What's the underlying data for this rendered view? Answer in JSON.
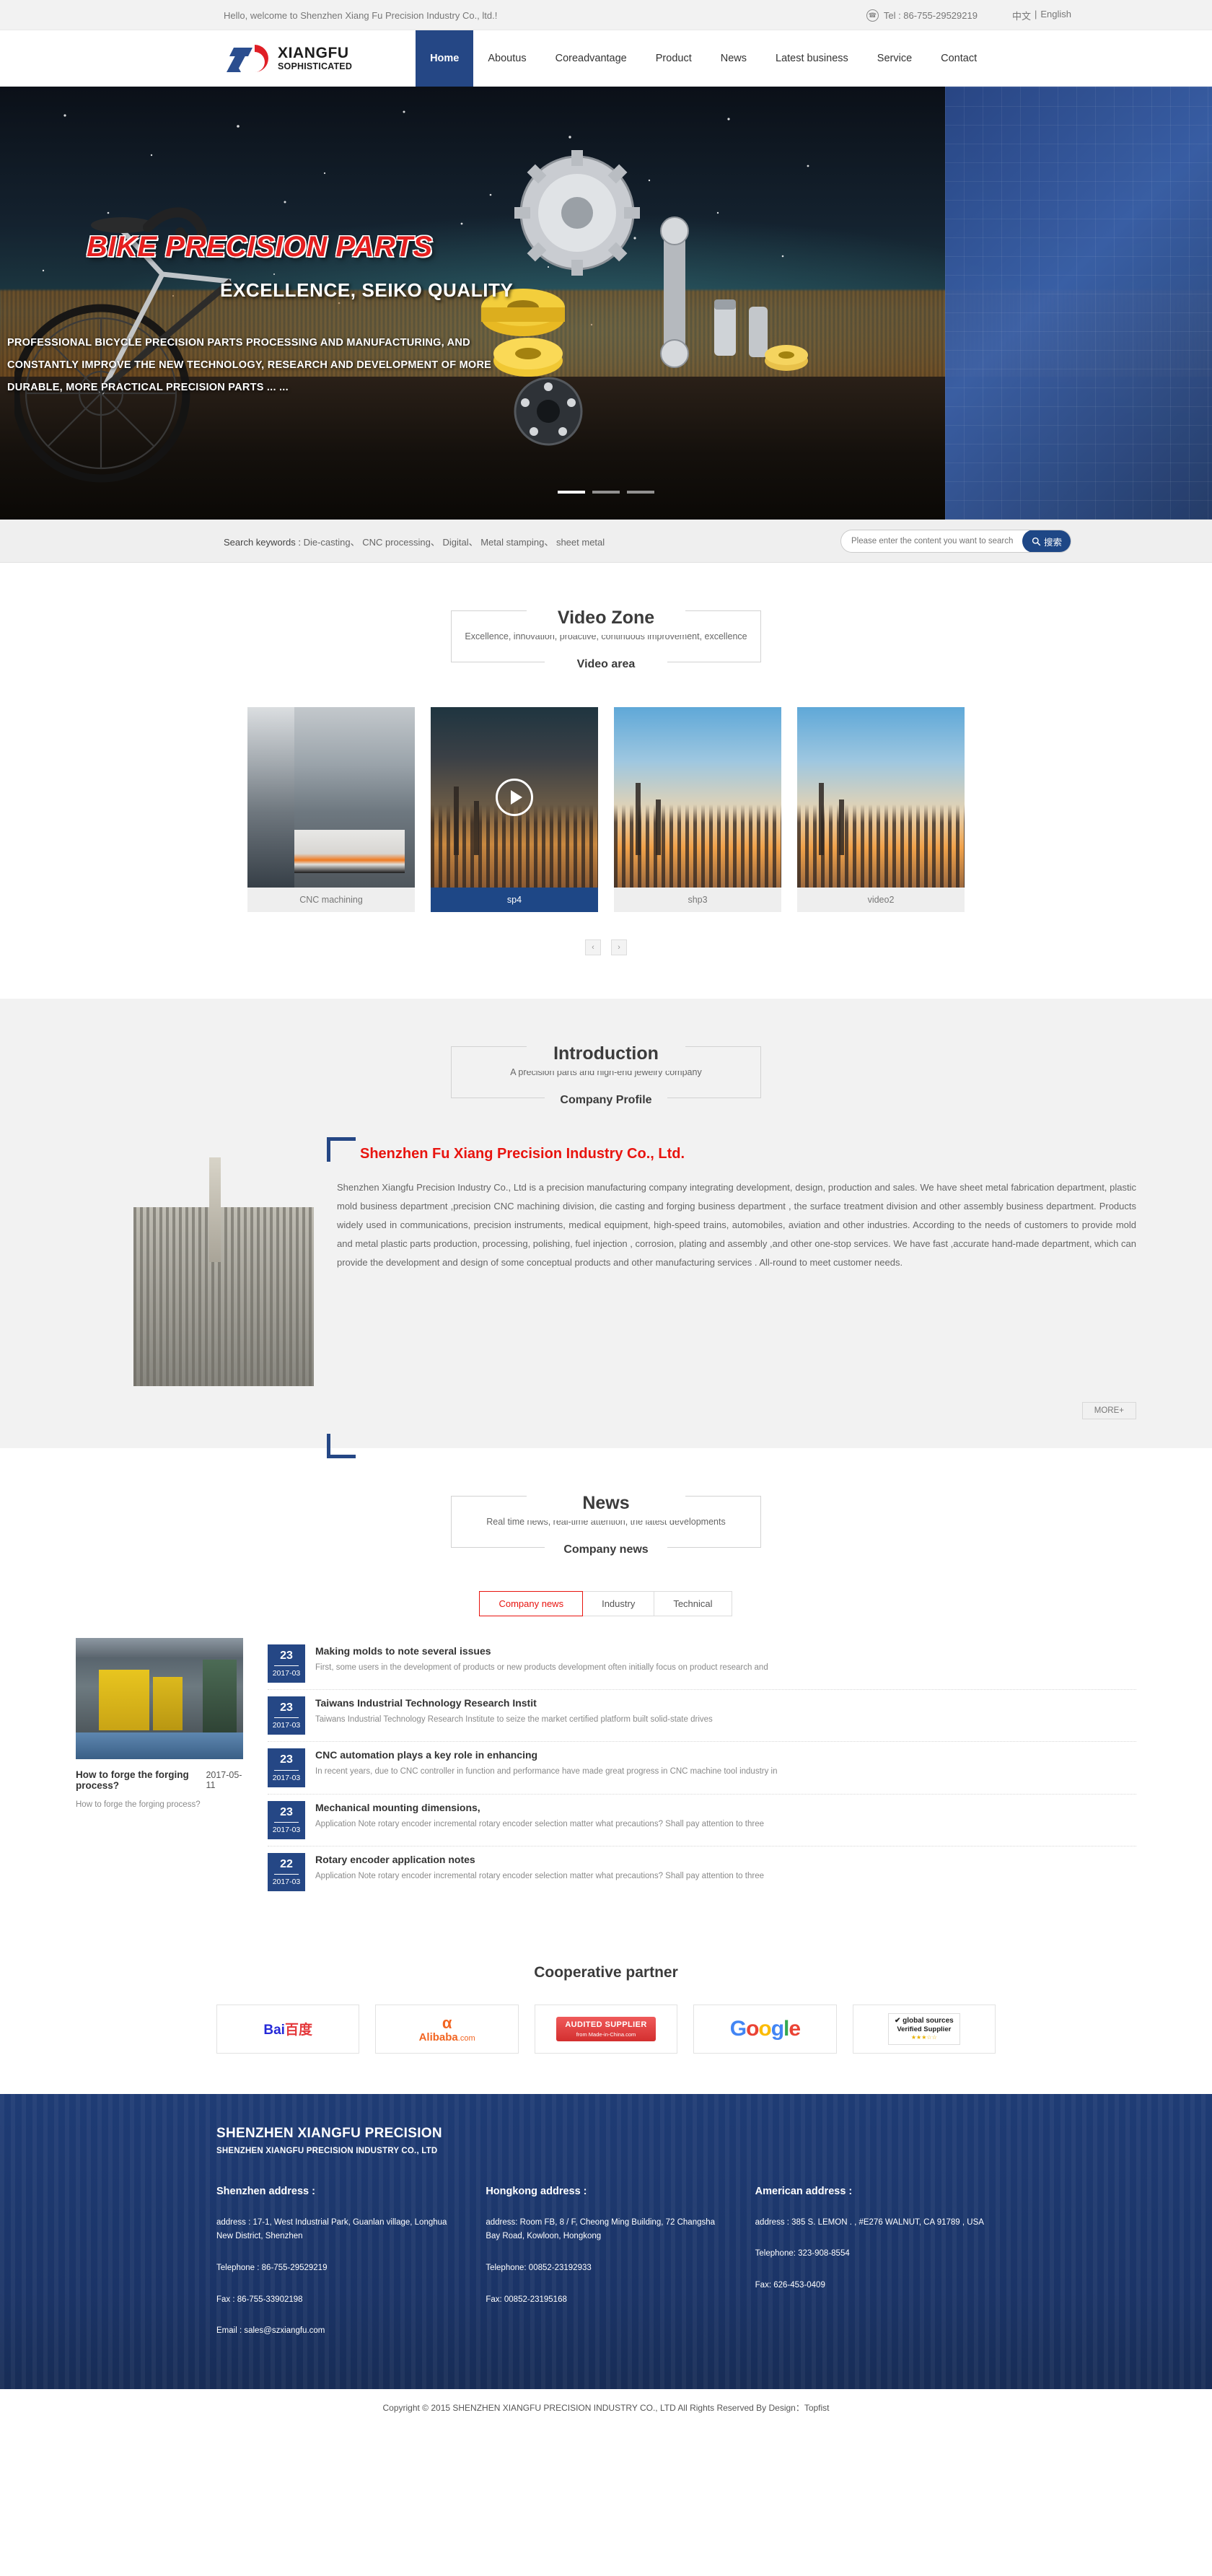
{
  "topbar": {
    "welcome": "Hello, welcome to Shenzhen Xiang Fu Precision Industry Co., ltd.!",
    "tel": "Tel : 86-755-29529219",
    "lang_cn": "中文",
    "lang_sep": "|",
    "lang_en": "English"
  },
  "header": {
    "logo_main": "XIANGFU",
    "logo_sub": "SOPHISTICATED",
    "nav": [
      {
        "label": "Home",
        "active": true
      },
      {
        "label": "Aboutus",
        "active": false
      },
      {
        "label": "Coreadvantage",
        "active": false
      },
      {
        "label": "Product",
        "active": false
      },
      {
        "label": "News",
        "active": false
      },
      {
        "label": "Latest business",
        "active": false
      },
      {
        "label": "Service",
        "active": false
      },
      {
        "label": "Contact",
        "active": false
      }
    ]
  },
  "hero": {
    "title": "BIKE PRECISION PARTS",
    "subtitle": "EXCELLENCE, SEIKO QUALITY",
    "description": "PROFESSIONAL BICYCLE PRECISION PARTS PROCESSING AND MANUFACTURING, AND CONSTANTLY IMPROVE THE NEW TECHNOLOGY, RESEARCH AND DEVELOPMENT OF MORE DURABLE, MORE PRACTICAL PRECISION PARTS ... ...",
    "slides": 3,
    "active_slide": 1
  },
  "search": {
    "keywords_label": "Search keywords :",
    "keywords": "Die-casting、 CNC processing、 Digital、 Metal stamping、 sheet metal",
    "placeholder": "Please enter the content you want to search",
    "button": "搜索"
  },
  "video": {
    "title": "Video Zone",
    "subtitle": "Excellence, innovation, proactive, continuous improvement, excellence",
    "bottom_label": "Video area",
    "items": [
      {
        "caption": "CNC machining",
        "active": false,
        "thumb": "factory",
        "play": false
      },
      {
        "caption": "sp4",
        "active": true,
        "thumb": "city-dark",
        "play": true
      },
      {
        "caption": "shp3",
        "active": false,
        "thumb": "city-bright",
        "play": false
      },
      {
        "caption": "video2",
        "active": false,
        "thumb": "city-bright",
        "play": false
      }
    ],
    "prev": "‹",
    "next": "›"
  },
  "intro": {
    "title": "Introduction",
    "subtitle": "A precision parts and high-end jewelry company",
    "bottom_label": "Company Profile",
    "company_name": "Shenzhen Fu Xiang Precision Industry Co., Ltd.",
    "body": "Shenzhen Xiangfu Precision Industry Co., Ltd is a precision manufacturing company integrating development, design, production and sales. We have sheet metal fabrication department, plastic mold business department ,precision CNC machining division, die casting and forging business department , the surface treatment division and other assembly business department. Products widely used in communications, precision instruments, medical equipment, high-speed trains, automobiles, aviation and other industries. According to the needs of customers to provide mold and metal plastic parts production, processing, polishing, fuel injection , corrosion, plating and assembly ,and other one-stop services. We have fast ,accurate hand-made department, which can provide the development and design of some conceptual products and other manufacturing services . All-round to meet customer needs.",
    "more": "MORE+"
  },
  "news": {
    "title": "News",
    "subtitle": "Real time news, real-time attention, the latest developments",
    "bottom_label": "Company news",
    "tabs": [
      {
        "label": "Company news",
        "active": true
      },
      {
        "label": "Industry",
        "active": false
      },
      {
        "label": "Technical",
        "active": false
      }
    ],
    "feature": {
      "title": "How to forge the forging process?",
      "date": "2017-05-11",
      "desc": "How to forge the forging process?"
    },
    "items": [
      {
        "day": "23",
        "ym": "2017-03",
        "title": "Making molds to note several issues",
        "desc": "First, some users in the development of products or new products development often initially focus on product research and"
      },
      {
        "day": "23",
        "ym": "2017-03",
        "title": "Taiwans Industrial Technology Research Instit",
        "desc": "Taiwans Industrial Technology Research Institute to seize the market certified platform built solid-state drives"
      },
      {
        "day": "23",
        "ym": "2017-03",
        "title": "CNC automation plays a key role in enhancing",
        "desc": "In recent years, due to CNC controller in function and performance have made great progress in CNC machine tool industry in"
      },
      {
        "day": "23",
        "ym": "2017-03",
        "title": "Mechanical mounting dimensions,",
        "desc": "Application Note rotary encoder incremental rotary encoder selection matter what precautions? Shall pay attention to three"
      },
      {
        "day": "22",
        "ym": "2017-03",
        "title": "Rotary encoder application notes",
        "desc": "Application Note rotary encoder incremental rotary encoder selection matter what precautions? Shall pay attention to three"
      }
    ]
  },
  "partners": {
    "title": "Cooperative partner",
    "items": [
      {
        "name": "Baidu",
        "text_a": "Bai",
        "text_b": "百度"
      },
      {
        "name": "Alibaba",
        "text_a": "Alibaba",
        "text_b": ".com"
      },
      {
        "name": "Made-in-China Audited Supplier",
        "text_a": "AUDITED SUPPLIER",
        "text_b": "from Made-in-China.com"
      },
      {
        "name": "Google",
        "text_a": "Google",
        "text_b": ""
      },
      {
        "name": "Global Sources Verified Supplier",
        "text_a": "global sources",
        "text_b": "Verified Supplier"
      }
    ]
  },
  "footer": {
    "brand": "SHENZHEN XIANGFU PRECISION",
    "brand_sub": "SHENZHEN XIANGFU PRECISION INDUSTRY CO., LTD",
    "columns": [
      {
        "heading": "Shenzhen address :",
        "address": "address : 17-1, West Industrial Park, Guanlan village, Longhua New District, Shenzhen",
        "telephone": "Telephone : 86-755-29529219",
        "fax": "Fax : 86-755-33902198",
        "email": "Email : sales@szxiangfu.com"
      },
      {
        "heading": "Hongkong address :",
        "address": "address: Room FB, 8 / F, Cheong Ming Building, 72 Changsha Bay Road, Kowloon, Hongkong",
        "telephone": "Telephone: 00852-23192933",
        "fax": "Fax: 00852-23195168",
        "email": ""
      },
      {
        "heading": "American address :",
        "address": "address : 385 S. LEMON . , #E276 WALNUT, CA 91789 , USA",
        "telephone": "Telephone: 323-908-8554",
        "fax": "Fax: 626-453-0409",
        "email": ""
      }
    ],
    "copyright": "Copyright © 2015 SHENZHEN XIANGFU PRECISION INDUSTRY CO., LTD All Rights Reserved By Design：Topfist"
  }
}
